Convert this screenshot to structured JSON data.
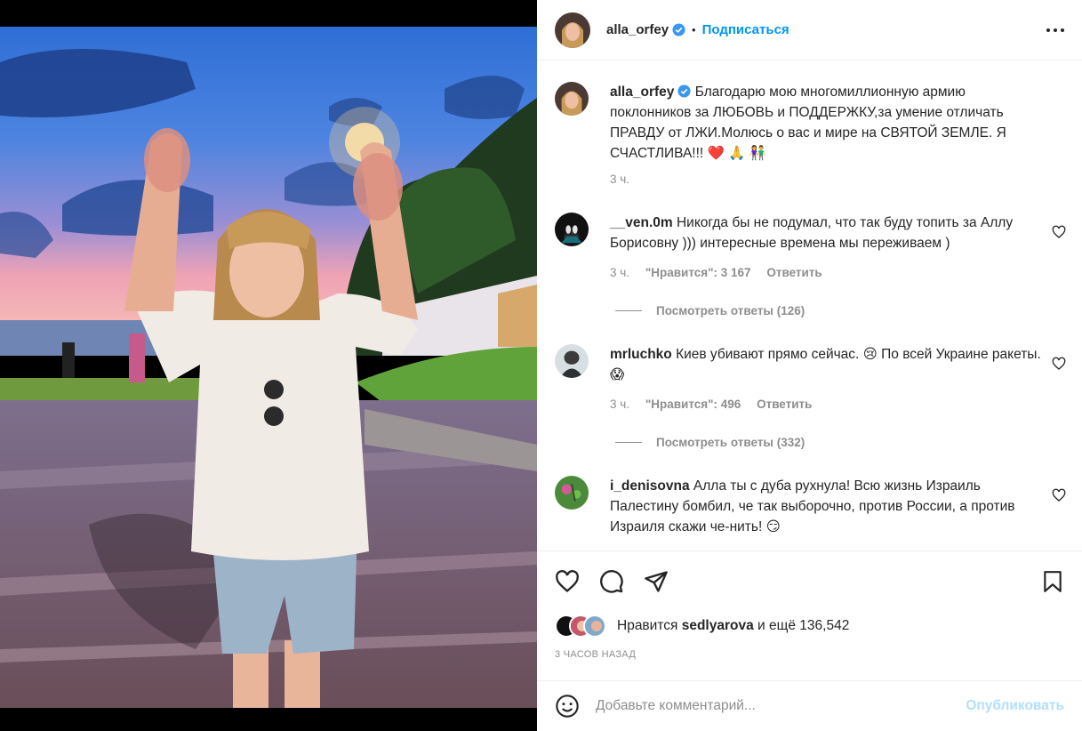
{
  "post": {
    "author": "alla_orfey",
    "follow_label": "Подписаться",
    "separator": "•",
    "caption": "Благодарю мою многомиллионную армию поклонников за ЛЮБОВЬ и ПОДДЕРЖКУ,за умение отличать ПРАВДУ от ЛЖИ.Молюсь о вас и мире на СВЯТОЙ ЗЕМЛЕ. Я СЧАСТЛИВА!!!",
    "caption_emoji": "❤️ 🙏 👫",
    "caption_time": "3 ч."
  },
  "comments": [
    {
      "user": "__ven.0m",
      "text": "Никогда бы не подумал, что так буду топить за Аллу Борисовну ))) интересные времена мы переживаем )",
      "time": "3 ч.",
      "likes": "\"Нравится\": 3 167",
      "reply": "Ответить",
      "view_replies": "Посмотреть ответы (126)"
    },
    {
      "user": "mrluchko",
      "text": "Киев убивают прямо сейчас. 😢 По всей Украине ракеты. 😱",
      "time": "3 ч.",
      "likes": "\"Нравится\": 496",
      "reply": "Ответить",
      "view_replies": "Посмотреть ответы (332)"
    },
    {
      "user": "i_denisovna",
      "text": "Алла ты с дуба рухнула! Всю жизнь Израиль Палестину бомбил, че так выборочно, против России, а против Израиля скажи че-нить! 😏"
    }
  ],
  "likes_bar": {
    "prefix": "Нравится",
    "user": "sedlyarova",
    "suffix": "и ещё 136,542"
  },
  "timestamp": "3 ЧАСОВ НАЗАД",
  "add_comment": {
    "placeholder": "Добавьте комментарий...",
    "post_label": "Опубликовать"
  },
  "icons": [
    "heart-icon",
    "comment-icon",
    "share-icon",
    "bookmark-icon",
    "emoji-icon",
    "more-icon",
    "verified-icon"
  ],
  "colors": {
    "accent": "#0095f6",
    "post_disabled": "#b2dffc",
    "muted": "#8e8e8e",
    "like_heart": "#ed4956"
  }
}
